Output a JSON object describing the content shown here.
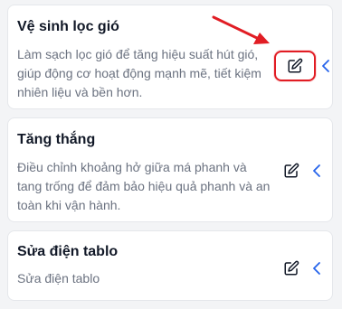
{
  "tasks": [
    {
      "title": "Vệ sinh lọc gió",
      "description": "Làm sạch lọc gió để tăng hiệu suất hút gió, giúp động cơ hoạt động mạnh mẽ, tiết kiệm nhiên liệu và bền hơn."
    },
    {
      "title": "Tăng thắng",
      "description": "Điều chỉnh khoảng hở giữa má phanh và tang trống để đảm bảo hiệu quả phanh và an toàn khi vận hành."
    },
    {
      "title": "Sửa điện tablo",
      "description": "Sửa điện tablo"
    }
  ],
  "icons": {
    "edit": "edit-icon",
    "chevron": "chevron-left-icon",
    "annotation": "red-arrow"
  },
  "colors": {
    "accent_blue": "#2563eb",
    "annotation_red": "#e11d24"
  }
}
